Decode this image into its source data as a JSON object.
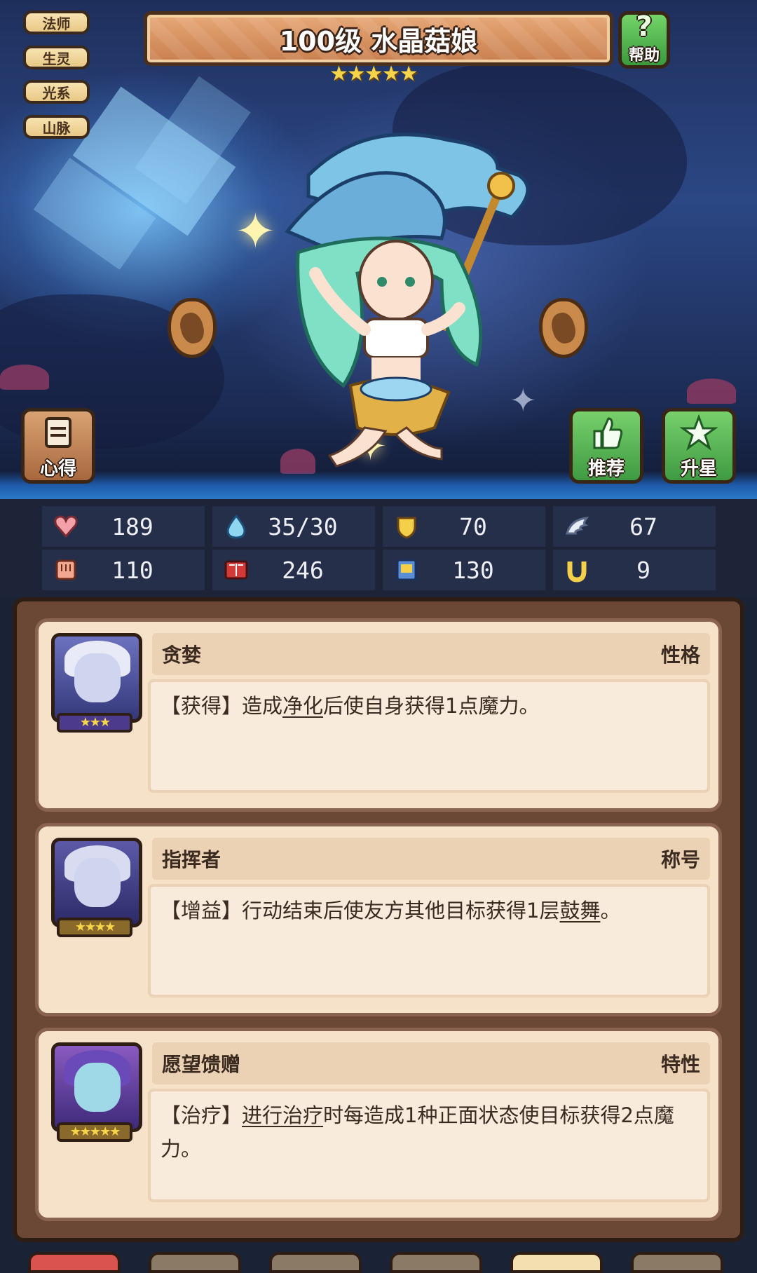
{
  "tags": [
    "法师",
    "生灵",
    "光系",
    "山脉"
  ],
  "header": {
    "title": "100级 水晶菇娘",
    "stars": "★★★★★",
    "help_label": "帮助"
  },
  "buttons": {
    "insight": "心得",
    "recommend": "推荐",
    "star_up": "升星"
  },
  "stats": [
    {
      "icon": "heart-icon",
      "value": "189"
    },
    {
      "icon": "water-drop-icon",
      "value": "35/30"
    },
    {
      "icon": "shield-icon",
      "value": "70"
    },
    {
      "icon": "wing-icon",
      "value": "67"
    },
    {
      "icon": "fist-icon",
      "value": "110"
    },
    {
      "icon": "spellbook-icon",
      "value": "246"
    },
    {
      "icon": "scroll-icon",
      "value": "130"
    },
    {
      "icon": "horseshoe-icon",
      "value": "9"
    }
  ],
  "traits": [
    {
      "name": "贪婪",
      "type": "性格",
      "stars": "★★★",
      "desc_prefix": "【获得】造成",
      "desc_link": "净化",
      "desc_suffix": "后使自身获得1点魔力。"
    },
    {
      "name": "指挥者",
      "type": "称号",
      "stars": "★★★★",
      "desc_prefix": "【增益】行动结束后使友方其他目标获得1层",
      "desc_link": "鼓舞",
      "desc_suffix": "。"
    },
    {
      "name": "愿望馈赠",
      "type": "特性",
      "stars": "★★★★★",
      "desc_prefix": "【治疗】",
      "desc_link": "进行治疗",
      "desc_suffix": "时每造成1种正面状态使目标获得2点魔力。"
    }
  ],
  "colors": {
    "panel_brown": "#6b4836",
    "card_cream": "#f6e2c9",
    "star_gold": "#f6d54a",
    "green_button": "#4fae47"
  }
}
